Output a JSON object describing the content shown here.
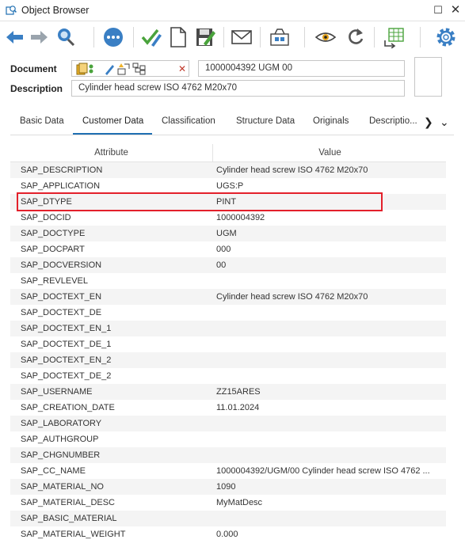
{
  "window": {
    "title": "Object Browser",
    "maximize_icon": "maximize-icon",
    "close_icon": "close-icon"
  },
  "toolbar": {
    "icons": [
      "back-icon",
      "forward-icon",
      "find-object-icon",
      "more-icon",
      "check-edit-icon",
      "new-document-icon",
      "save-edit-icon",
      "mail-icon",
      "where-used-icon",
      "display-icon",
      "refresh-icon",
      "export-table-icon",
      "settings-icon"
    ]
  },
  "header": {
    "document_label": "Document",
    "description_label": "Description",
    "document_value": "1000004392  UGM  00",
    "description_value": "Cylinder head screw ISO 4762 M20x70",
    "clear_icon": "clear-icon"
  },
  "tabs": [
    {
      "label": "Basic Data",
      "active": false
    },
    {
      "label": "Customer Data",
      "active": true
    },
    {
      "label": "Classification",
      "active": false
    },
    {
      "label": "Structure Data",
      "active": false
    },
    {
      "label": "Originals",
      "active": false
    },
    {
      "label": "Descriptio...",
      "active": false
    }
  ],
  "table": {
    "columns": [
      "Attribute",
      "Value"
    ],
    "rows": [
      [
        "SAP_DESCRIPTION",
        "Cylinder head screw ISO 4762 M20x70"
      ],
      [
        "SAP_APPLICATION",
        "UGS:P"
      ],
      [
        "SAP_DTYPE",
        "PINT"
      ],
      [
        "SAP_DOCID",
        "1000004392"
      ],
      [
        "SAP_DOCTYPE",
        "UGM"
      ],
      [
        "SAP_DOCPART",
        "000"
      ],
      [
        "SAP_DOCVERSION",
        "00"
      ],
      [
        "SAP_REVLEVEL",
        ""
      ],
      [
        "SAP_DOCTEXT_EN",
        "Cylinder head screw ISO 4762 M20x70"
      ],
      [
        "SAP_DOCTEXT_DE",
        ""
      ],
      [
        "SAP_DOCTEXT_EN_1",
        ""
      ],
      [
        "SAP_DOCTEXT_DE_1",
        ""
      ],
      [
        "SAP_DOCTEXT_EN_2",
        ""
      ],
      [
        "SAP_DOCTEXT_DE_2",
        ""
      ],
      [
        "SAP_USERNAME",
        "ZZ15ARES"
      ],
      [
        "SAP_CREATION_DATE",
        "11.01.2024"
      ],
      [
        "SAP_LABORATORY",
        ""
      ],
      [
        "SAP_AUTHGROUP",
        ""
      ],
      [
        "SAP_CHGNUMBER",
        ""
      ],
      [
        "SAP_CC_NAME",
        "1000004392/UGM/00 Cylinder head screw ISO 4762 ..."
      ],
      [
        "SAP_MATERIAL_NO",
        "1090"
      ],
      [
        "SAP_MATERIAL_DESC",
        "MyMatDesc"
      ],
      [
        "SAP_BASIC_MATERIAL",
        ""
      ],
      [
        "SAP_MATERIAL_WEIGHT",
        "0.000"
      ]
    ],
    "highlighted_row": "SAP_DTYPE"
  },
  "colors": {
    "accent": "#1f6fb2",
    "highlight": "#e3202b",
    "row_alt": "#f4f4f4"
  }
}
